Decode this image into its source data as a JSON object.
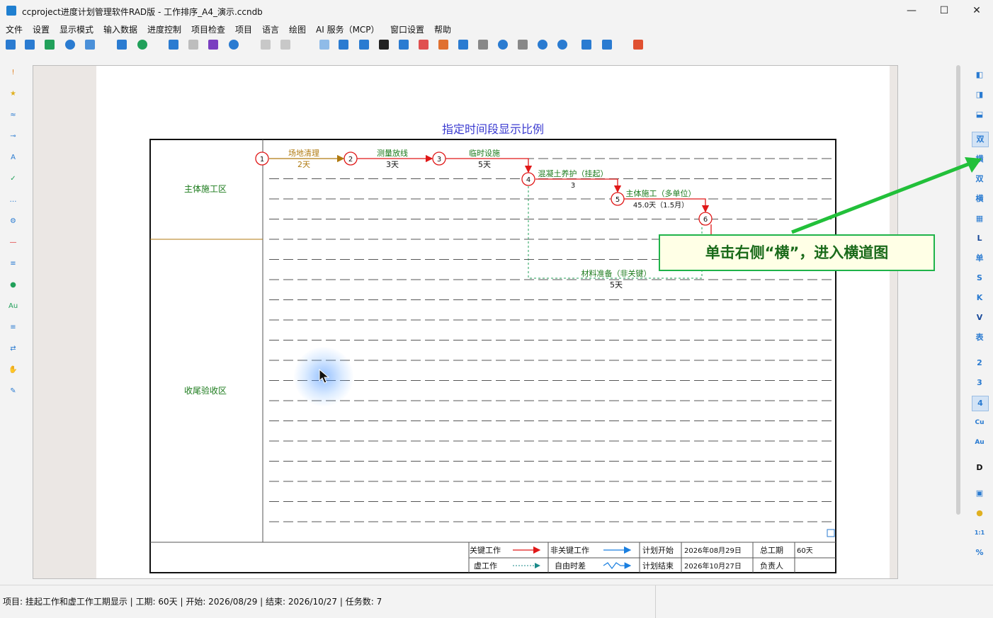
{
  "window": {
    "title": "ccproject进度计划管理软件RAD版 - 工作排序_A4_演示.ccndb",
    "minimize": "—",
    "maximize": "☐",
    "close": "✕"
  },
  "menu": [
    "文件",
    "设置",
    "显示模式",
    "输入数据",
    "进度控制",
    "项目检查",
    "项目",
    "语言",
    "绘图",
    "AI 服务（MCP）",
    "窗口设置",
    "帮助"
  ],
  "diagram": {
    "title": "指定时间段显示比例",
    "zones": [
      "主体施工区",
      "收尾验收区"
    ],
    "nodes": [
      "1",
      "2",
      "3",
      "4",
      "5",
      "6"
    ],
    "tasks": [
      {
        "name": "场地清理",
        "duration": "2天"
      },
      {
        "name": "测量放线",
        "duration": "3天"
      },
      {
        "name": "临时设施",
        "duration": "5天"
      },
      {
        "name": "混凝土养护（挂起）",
        "duration": "3"
      },
      {
        "name": "主体施工（多单位）",
        "duration": "45.0天（1.5月）"
      },
      {
        "name": "材料准备（非关键）",
        "duration": "5天"
      }
    ],
    "legend": {
      "critical": "关键工作",
      "noncritical": "非关键工作",
      "dummy": "虚工作",
      "free_float": "自由时差",
      "plan_start_label": "计划开始",
      "plan_start": "2026年08月29日",
      "plan_end_label": "计划结束",
      "plan_end": "2026年10月27日",
      "total_duration_label": "总工期",
      "total_duration": "60天",
      "owner_label": "负责人",
      "owner": ""
    }
  },
  "right_toolbar": [
    "双",
    "横",
    "双",
    "横",
    "L",
    "单",
    "S",
    "K",
    "V",
    "表",
    "2",
    "3",
    "4",
    "Cu",
    "Au",
    "D"
  ],
  "callout": "单击右侧“横”，进入横道图",
  "status": "项目: 挂起工作和虚工作工期显示 | 工期: 60天 | 开始: 2026/08/29 | 结束: 2026/10/27 | 任务数: 7",
  "colors": {
    "critical": "#e01818",
    "noncritical": "#1a7fe0",
    "dummy": "#1a8a8a",
    "zone_text": "#1a7a1a",
    "title_text": "#3a3ad0",
    "callout_border": "#1fb34a"
  }
}
